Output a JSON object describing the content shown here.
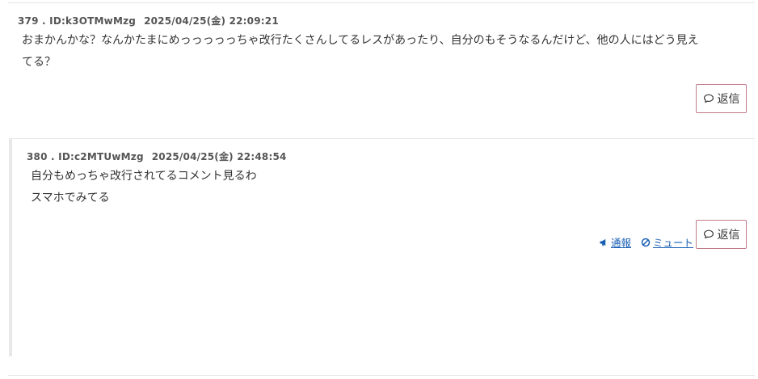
{
  "posts": [
    {
      "number": "379",
      "sep": " . ",
      "id": "ID:k3OTMwMzg",
      "date": "2025/04/25(金) 22:09:21",
      "lines": [
        "おまかんかな？なんかたまにめっっっっっちゃ改行たくさんしてるレスがあったり、自分のもそうなるんだけど、他の人にはどう見え",
        "てる？"
      ],
      "reply_label": "返信"
    },
    {
      "number": "380",
      "sep": " . ",
      "id": "ID:c2MTUwMzg",
      "date": "2025/04/25(金) 22:48:54",
      "lines": [
        "自分もめっちゃ改行されてるコメント見るわ",
        "スマホでみてる"
      ],
      "report_label": "通報",
      "mute_label": "ミュート",
      "reply_label": "返信"
    }
  ],
  "icons": {
    "reply": "speech-bubble-icon",
    "report": "megaphone-icon",
    "mute": "prohibited-icon"
  },
  "colors": {
    "link": "#1a5fb4",
    "button_border": "#c07a8a"
  }
}
